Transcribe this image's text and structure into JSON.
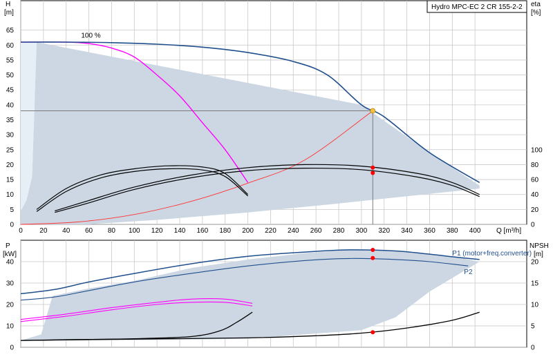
{
  "title_box": "Hydro MPC-EC 2 CR 155-2-2",
  "colors": {
    "envelope": "#ccd7e3",
    "envelope_light": "#e6eef6",
    "grid": "#c8c8c8",
    "duty_line": "#7a7a7a",
    "curve_blue": "#1f4e8c",
    "curve_magenta": "#ff00ff",
    "curve_black": "#000000",
    "system_curve": "#ff3333",
    "duty_point_fill": "#f5c242",
    "marker_red": "#ff0000"
  },
  "chart_data": [
    {
      "type": "line",
      "name": "head-efficiency",
      "xlabel": "Q [m³/h]",
      "ylabel_left": [
        "H",
        "[m]"
      ],
      "ylabel_right": [
        "eta",
        "[%]"
      ],
      "xlim": [
        0,
        420
      ],
      "xticks": [
        0,
        20,
        40,
        60,
        80,
        100,
        120,
        140,
        160,
        180,
        200,
        220,
        240,
        260,
        280,
        300,
        320,
        340,
        360,
        380,
        400
      ],
      "ylim": [
        0,
        70
      ],
      "yticks": [
        0,
        5,
        10,
        15,
        20,
        25,
        30,
        35,
        40,
        45,
        50,
        55,
        60,
        65
      ],
      "y2lim": [
        0,
        100
      ],
      "y2ticks": [
        0,
        20,
        40,
        60,
        80,
        100
      ],
      "y2_zero_at_y": 0,
      "y2_hundred_at_y": 25,
      "grid": true,
      "annotation": "100 %",
      "annotation_at": [
        55,
        62
      ],
      "duty_point": [
        310,
        38
      ],
      "envelope": [
        [
          0,
          4.5
        ],
        [
          5,
          8
        ],
        [
          10,
          16
        ],
        [
          14,
          61
        ],
        [
          300,
          40
        ],
        [
          360,
          24
        ],
        [
          404,
          13
        ],
        [
          404,
          12
        ],
        [
          330,
          9
        ],
        [
          280,
          7
        ],
        [
          200,
          4
        ],
        [
          120,
          1.5
        ],
        [
          70,
          0.3
        ],
        [
          60,
          0
        ],
        [
          0,
          0
        ]
      ],
      "envelope_light": [
        [
          0,
          4.5
        ],
        [
          5,
          8
        ],
        [
          10,
          16
        ],
        [
          14,
          61
        ],
        [
          0,
          61
        ]
      ],
      "system_curve": [
        [
          0,
          0
        ],
        [
          50,
          0.8
        ],
        [
          100,
          3.3
        ],
        [
          150,
          7.7
        ],
        [
          200,
          13.8
        ],
        [
          250,
          21.5
        ],
        [
          310,
          38
        ]
      ],
      "head_curve_blue": [
        [
          0,
          61
        ],
        [
          40,
          61
        ],
        [
          80,
          60.8
        ],
        [
          120,
          60.3
        ],
        [
          160,
          59.3
        ],
        [
          200,
          57.5
        ],
        [
          240,
          54.5
        ],
        [
          270,
          50
        ],
        [
          300,
          40
        ],
        [
          320,
          36
        ],
        [
          360,
          24
        ],
        [
          404,
          14
        ]
      ],
      "head_curve_magenta": [
        [
          0,
          61
        ],
        [
          40,
          61
        ],
        [
          60,
          60.5
        ],
        [
          80,
          59
        ],
        [
          100,
          56
        ],
        [
          120,
          50
        ],
        [
          140,
          43
        ],
        [
          160,
          34
        ],
        [
          180,
          25
        ],
        [
          200,
          14
        ]
      ],
      "eff_curves": [
        [
          [
            14,
            5
          ],
          [
            40,
            12
          ],
          [
            70,
            16.5
          ],
          [
            100,
            18.6
          ],
          [
            130,
            19.6
          ],
          [
            160,
            19.2
          ],
          [
            180,
            17
          ],
          [
            200,
            10
          ]
        ],
        [
          [
            14,
            4.3
          ],
          [
            40,
            11
          ],
          [
            70,
            15.5
          ],
          [
            100,
            17.7
          ],
          [
            130,
            18.6
          ],
          [
            160,
            18.2
          ],
          [
            180,
            16
          ],
          [
            200,
            9.5
          ]
        ],
        [
          [
            30,
            4.5
          ],
          [
            60,
            8
          ],
          [
            100,
            12.5
          ],
          [
            150,
            16.5
          ],
          [
            200,
            19
          ],
          [
            250,
            20
          ],
          [
            300,
            19.5
          ],
          [
            350,
            17
          ],
          [
            380,
            14
          ],
          [
            404,
            10
          ]
        ],
        [
          [
            30,
            4
          ],
          [
            60,
            7.2
          ],
          [
            100,
            11.7
          ],
          [
            150,
            15.6
          ],
          [
            200,
            18
          ],
          [
            250,
            18.8
          ],
          [
            300,
            18.3
          ],
          [
            350,
            15.8
          ],
          [
            380,
            13
          ],
          [
            404,
            9.3
          ]
        ]
      ],
      "markers": [
        [
          310,
          19
        ],
        [
          310,
          17.2
        ]
      ]
    },
    {
      "type": "line",
      "name": "power-npsh",
      "ylabel_left": [
        "P",
        "[kW]"
      ],
      "ylabel_right": [
        "NPSH",
        "[m]"
      ],
      "xlim": [
        0,
        420
      ],
      "ylim": [
        0,
        50
      ],
      "yticks": [
        0,
        10,
        20,
        30,
        40
      ],
      "y2lim": [
        0,
        25
      ],
      "y2ticks": [
        0,
        5,
        10,
        15,
        20
      ],
      "grid": true,
      "series": [
        {
          "name": "P1 (motor+freq.converter)",
          "color": "#1f4e8c",
          "label_at": [
            380,
            42.3
          ],
          "points": [
            [
              0,
              25
            ],
            [
              30,
              27
            ],
            [
              60,
              30.5
            ],
            [
              100,
              34.5
            ],
            [
              150,
              39
            ],
            [
              200,
              42.5
            ],
            [
              250,
              44.5
            ],
            [
              290,
              45.5
            ],
            [
              330,
              45
            ],
            [
              360,
              43.5
            ],
            [
              380,
              42.3
            ],
            [
              404,
              41
            ]
          ]
        },
        {
          "name": "P2",
          "color": "#1f4e8c",
          "label_at": [
            394,
            34.5
          ],
          "points": [
            [
              0,
              22
            ],
            [
              30,
              23.5
            ],
            [
              60,
              26.5
            ],
            [
              100,
              30.5
            ],
            [
              150,
              34.5
            ],
            [
              200,
              38
            ],
            [
              250,
              40.5
            ],
            [
              290,
              41.5
            ],
            [
              330,
              41
            ],
            [
              360,
              40
            ],
            [
              394,
              38
            ]
          ]
        }
      ],
      "magenta_curves": [
        [
          [
            0,
            13
          ],
          [
            40,
            15.5
          ],
          [
            80,
            18.5
          ],
          [
            120,
            21
          ],
          [
            150,
            22.5
          ],
          [
            180,
            22.5
          ],
          [
            204,
            20.5
          ]
        ],
        [
          [
            0,
            12
          ],
          [
            40,
            14.5
          ],
          [
            80,
            17.5
          ],
          [
            120,
            20
          ],
          [
            150,
            21
          ],
          [
            180,
            21
          ],
          [
            204,
            19.3
          ]
        ]
      ],
      "npsh_curves": [
        [
          [
            0,
            1.6
          ],
          [
            50,
            1.8
          ],
          [
            100,
            2
          ],
          [
            150,
            2.5
          ],
          [
            175,
            3.8
          ],
          [
            190,
            5.8
          ],
          [
            204,
            8.2
          ]
        ],
        [
          [
            0,
            1.6
          ],
          [
            100,
            1.9
          ],
          [
            200,
            2.2
          ],
          [
            260,
            2.7
          ],
          [
            300,
            3.3
          ],
          [
            340,
            4.5
          ],
          [
            380,
            6.3
          ],
          [
            404,
            8.2
          ]
        ]
      ],
      "markers_p": [
        [
          310,
          45.5
        ],
        [
          310,
          41.7
        ]
      ],
      "markers_npsh": [
        [
          310,
          3.5
        ]
      ],
      "envelope": [
        [
          0,
          3.2
        ],
        [
          18,
          6
        ],
        [
          28,
          24
        ],
        [
          60,
          27.5
        ],
        [
          100,
          31
        ],
        [
          150,
          37
        ],
        [
          200,
          41
        ],
        [
          250,
          44
        ],
        [
          290,
          45.5
        ],
        [
          330,
          45
        ],
        [
          380,
          42.5
        ],
        [
          404,
          40
        ],
        [
          360,
          26
        ],
        [
          330,
          14
        ],
        [
          300,
          8
        ],
        [
          200,
          4
        ],
        [
          100,
          3.3
        ],
        [
          0,
          3.2
        ]
      ]
    }
  ]
}
